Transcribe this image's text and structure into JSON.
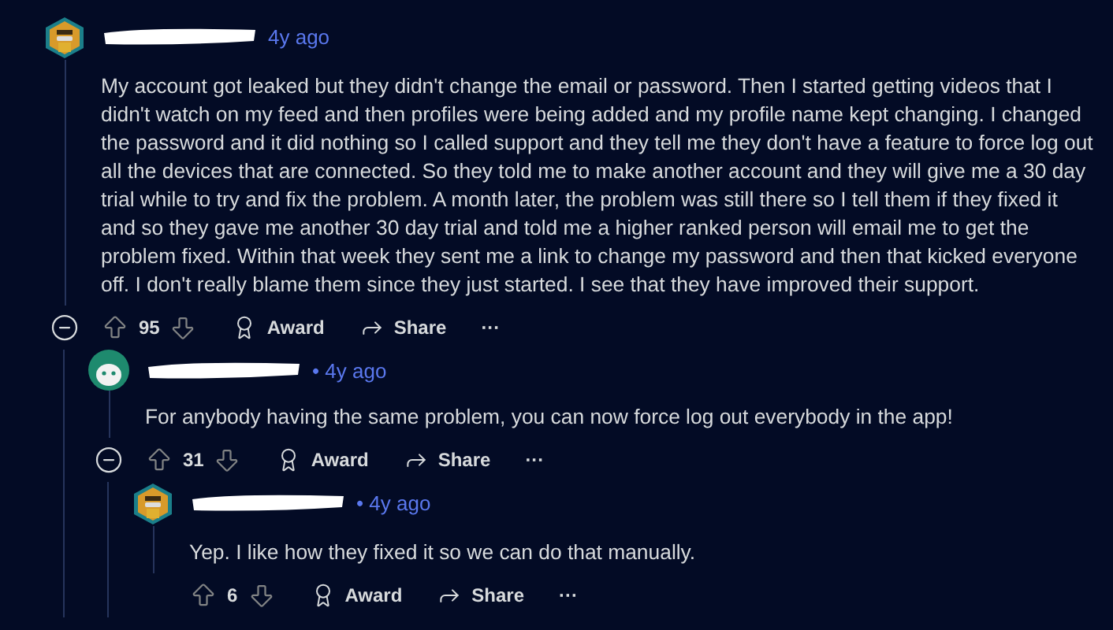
{
  "comments": [
    {
      "avatar": {
        "kind": "hexagon"
      },
      "time": "4y ago",
      "body": "My account got leaked but they didn't change the email or password. Then I started getting videos that I didn't watch on my feed and then profiles were being added and my profile name kept changing. I changed the password and it did nothing so I called support and they tell me they don't have a feature to force log out all the devices that are connected. So they told me to make another account and they will give me a 30 day trial while to try and fix the problem. A month later, the problem was still there so I tell them if they fixed it and so they gave me another 30 day trial and told me a higher ranked person will email me to get the problem fixed. Within that week they sent me a link to change my password and then that kicked everyone off. I don't really blame them since they just started. I see that they have improved their support.",
      "votes": "95",
      "award": "Award",
      "share": "Share",
      "more": "···",
      "expanded": true,
      "children": [
        {
          "avatar": {
            "kind": "round"
          },
          "time": "• 4y ago",
          "body": "For anybody having the same problem, you can now force log out everybody in the app!",
          "votes": "31",
          "award": "Award",
          "share": "Share",
          "more": "···",
          "expanded": true,
          "children": [
            {
              "avatar": {
                "kind": "hexagon"
              },
              "time": "• 4y ago",
              "body": "Yep. I like how they fixed it so we can do that manually.",
              "votes": "6",
              "award": "Award",
              "share": "Share",
              "more": "···"
            }
          ]
        }
      ]
    }
  ]
}
